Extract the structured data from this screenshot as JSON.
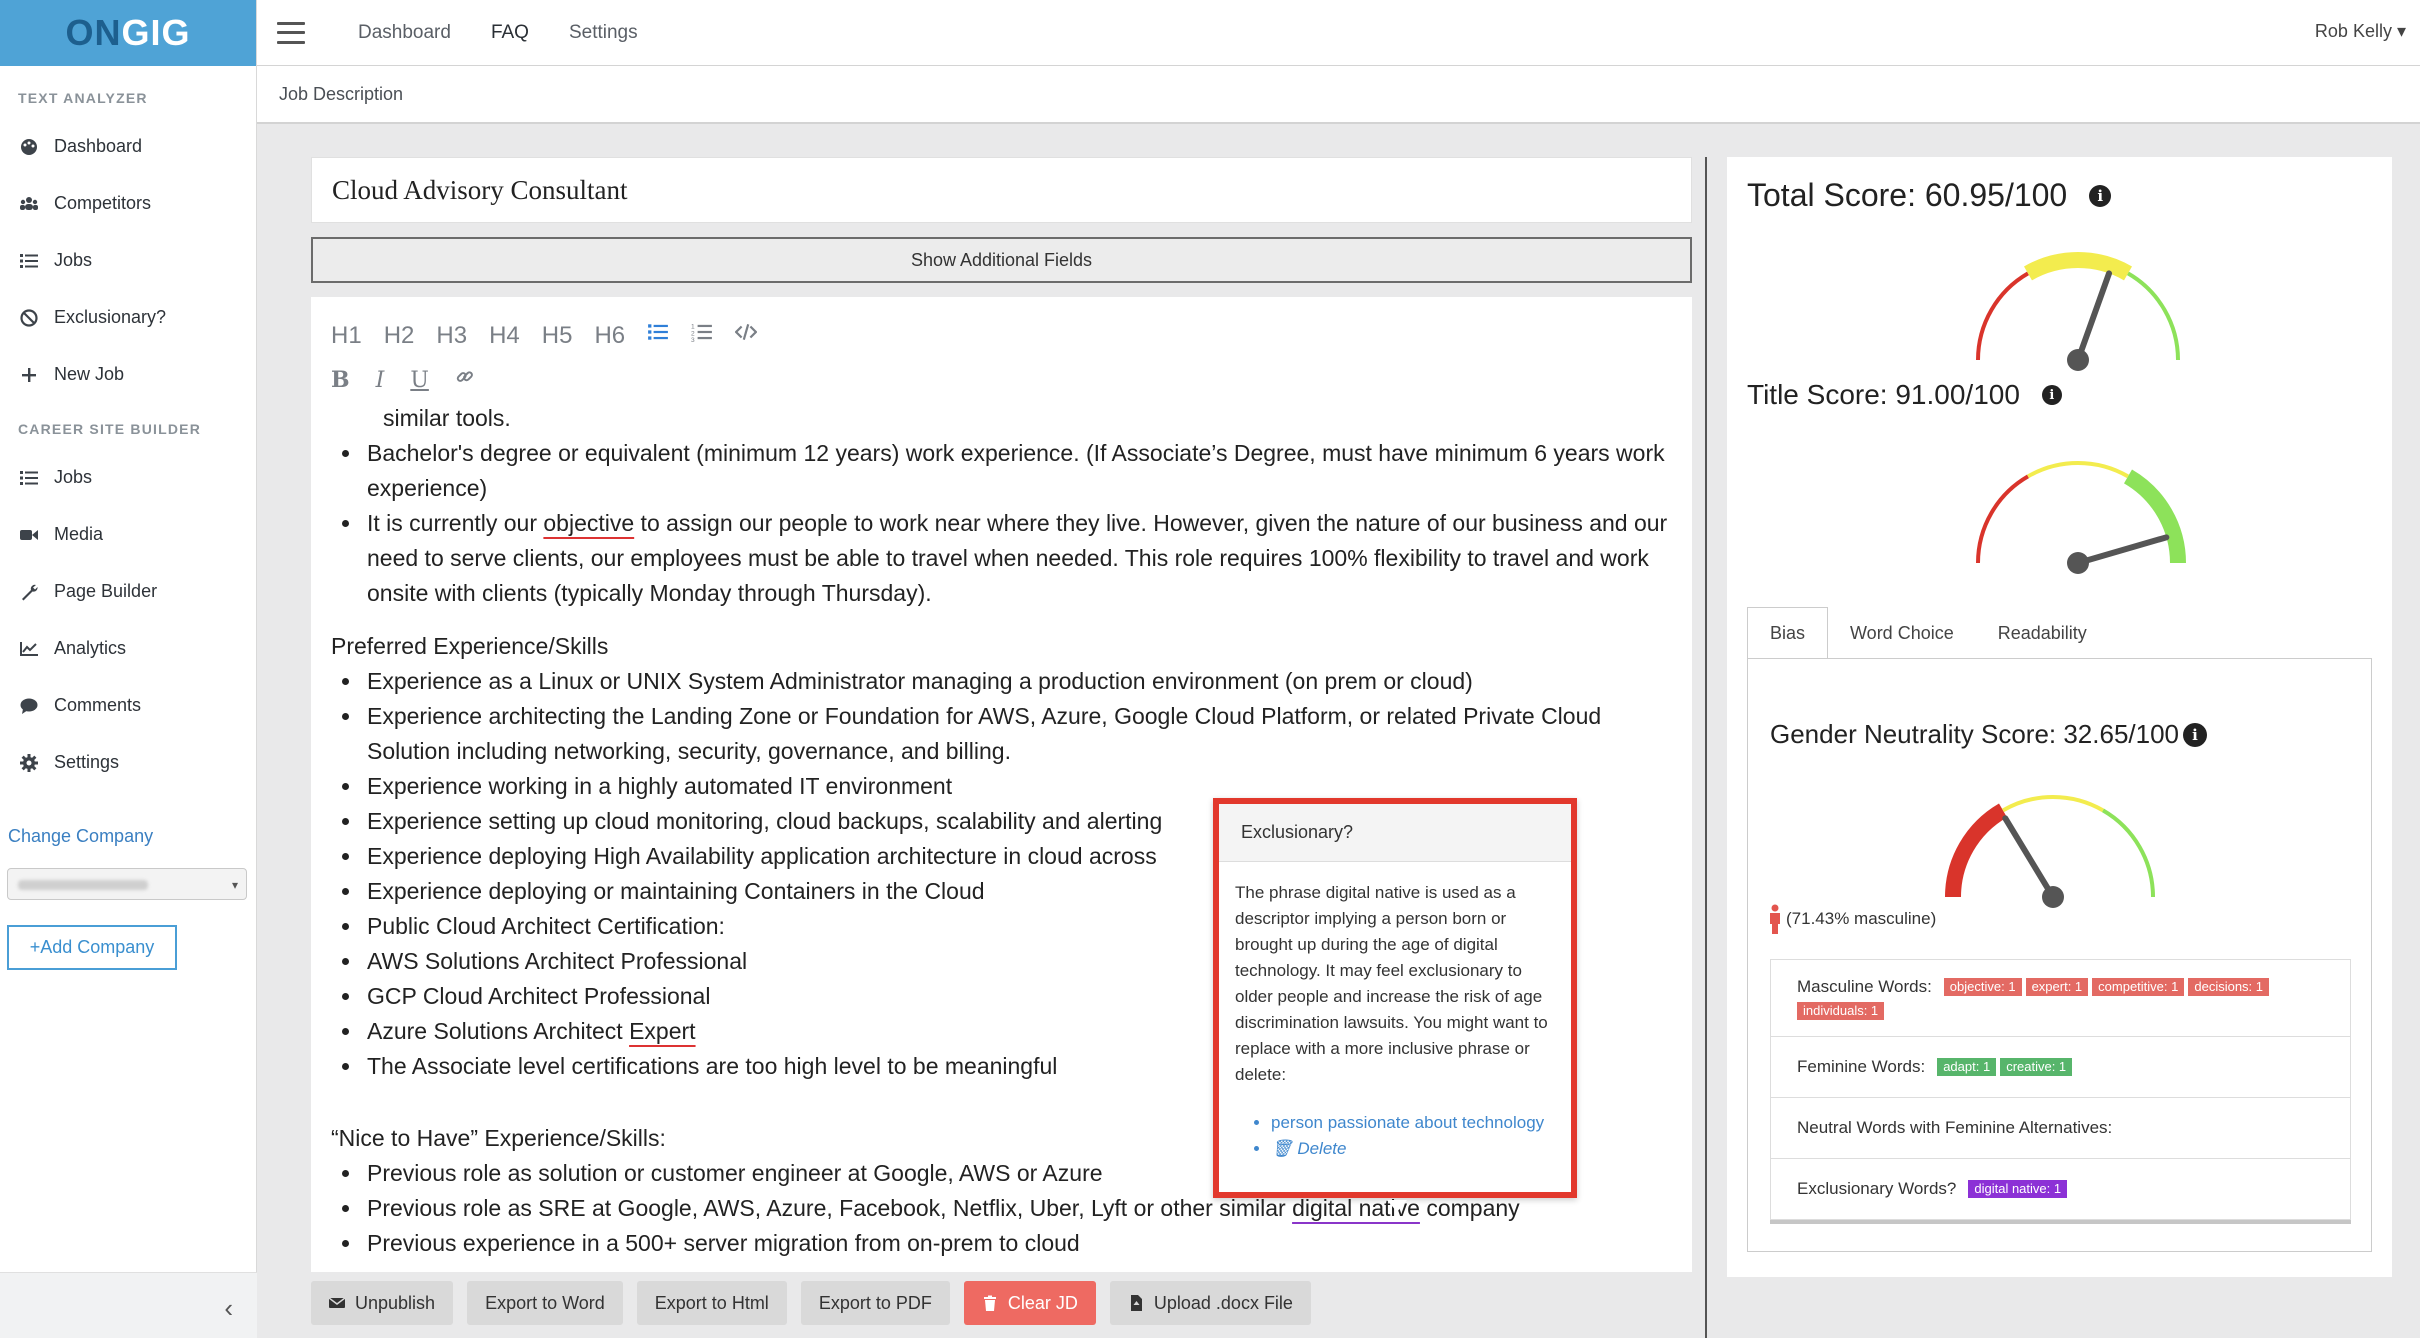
{
  "app": {
    "logo_text": "ONGIG"
  },
  "topnav": {
    "links": [
      "Dashboard",
      "FAQ",
      "Settings"
    ],
    "user": "Rob Kelly ▾"
  },
  "breadcrumb": "Job Description",
  "sidebar": {
    "section1": "TEXT ANALYZER",
    "text_analyzer_items": [
      {
        "label": "Dashboard",
        "icon": "palette-icon"
      },
      {
        "label": "Competitors",
        "icon": "users-icon"
      },
      {
        "label": "Jobs",
        "icon": "list-icon"
      },
      {
        "label": "Exclusionary?",
        "icon": "ban-icon"
      },
      {
        "label": "New Job",
        "icon": "plus-icon"
      }
    ],
    "section2": "CAREER SITE BUILDER",
    "career_items": [
      {
        "label": "Jobs",
        "icon": "list-icon"
      },
      {
        "label": "Media",
        "icon": "video-icon"
      },
      {
        "label": "Page Builder",
        "icon": "wrench-icon"
      },
      {
        "label": "Analytics",
        "icon": "chart-icon"
      },
      {
        "label": "Comments",
        "icon": "comment-icon"
      },
      {
        "label": "Settings",
        "icon": "gear-icon"
      }
    ],
    "change_company": "Change Company",
    "add_company": "+Add Company"
  },
  "editor": {
    "title": "Cloud Advisory Consultant",
    "show_fields": "Show Additional Fields",
    "toolbar": [
      "H1",
      "H2",
      "H3",
      "H4",
      "H5",
      "H6"
    ],
    "toolbar2": [
      "B",
      "I",
      "U"
    ],
    "continued_line": "similar tools.",
    "req_items": [
      {
        "text": "Bachelor's degree or equivalent (minimum 12 years) work experience. (If Associate’s Degree, must have minimum 6 years work experience)"
      }
    ],
    "objective_item": {
      "before": "It is currently our ",
      "flag": "objective",
      "after": " to assign our people to work near where they live. However, given the nature of our business and our need to serve clients, our employees must be able to travel when needed. This role requires 100% flexibility to travel and work onsite with clients (typically Monday through Thursday)."
    },
    "preferred_heading": "Preferred Experience/Skills",
    "preferred_items": [
      "Experience as a Linux or UNIX System Administrator managing a production environment (on prem or cloud)",
      "Experience architecting the Landing Zone or Foundation for AWS, Azure, Google Cloud Platform, or related Private Cloud Solution including networking, security, governance, and billing.",
      "Experience working in a highly automated IT environment",
      "Experience setting up cloud monitoring, cloud backups, scalability and alerting",
      "Experience deploying High Availability application architecture in cloud across",
      "Experience deploying or maintaining Containers in the Cloud",
      "Public Cloud Architect Certification:",
      "AWS Solutions Architect Professional",
      "GCP Cloud Architect Professional"
    ],
    "azure_item": {
      "before": "Azure Solutions Architect ",
      "flag": "Expert"
    },
    "associate_item": "The Associate level certifications are too high level to be meaningful",
    "nice_heading": "“Nice to Have” Experience/Skills:",
    "nice_items": [
      "Previous role as solution or customer engineer at Google, AWS or Azure"
    ],
    "sre_item": {
      "before": "Previous role as SRE at Google, AWS, Azure, Facebook, Netflix, Uber, Lyft or other similar ",
      "flag": "digital native",
      "after": " company"
    },
    "last_item": "Previous experience in a 500+ server migration from on-prem to cloud"
  },
  "actions": [
    {
      "label": "Unpublish",
      "icon": "envelope-icon"
    },
    {
      "label": "Export to Word",
      "icon": ""
    },
    {
      "label": "Export to Html",
      "icon": ""
    },
    {
      "label": "Export to PDF",
      "icon": ""
    },
    {
      "label": "Clear JD",
      "icon": "trash-icon"
    },
    {
      "label": "Upload .docx File",
      "icon": "file-icon"
    }
  ],
  "popover": {
    "title": "Exclusionary?",
    "body": "The phrase digital native is used as a descriptor implying a person born or brought up during the age of digital technology. It may feel exclusionary to older people and increase the risk of age discrimination lawsuits. You might want to replace with a more inclusive phrase or delete:",
    "suggestion": "person passionate about technology",
    "delete": "Delete"
  },
  "scores": {
    "total": {
      "label": "Total Score: 60.95/100",
      "value": 60.95
    },
    "title": {
      "label": "Title Score: 91.00/100",
      "value": 91.0
    },
    "gender": {
      "label": "Gender Neutrality Score: 32.65/100",
      "value": 32.65
    },
    "masculine_pct": "(71.43% masculine)",
    "tabs": [
      "Bias",
      "Word Choice",
      "Readability"
    ],
    "word_rows": [
      {
        "label": "Masculine Words:",
        "color": "red",
        "tags": [
          "objective: 1",
          "expert: 1",
          "competitive: 1",
          "decisions: 1",
          "individuals: 1"
        ]
      },
      {
        "label": "Feminine Words:",
        "color": "green",
        "tags": [
          "adapt: 1",
          "creative: 1"
        ]
      },
      {
        "label": "Neutral Words with Feminine Alternatives:",
        "color": "green",
        "tags": []
      },
      {
        "label": "Exclusionary Words?",
        "color": "purple",
        "tags": [
          "digital native: 1"
        ]
      }
    ]
  },
  "colors": {
    "brand": "#4fa3d6",
    "gauge_red": "#d9342b",
    "gauge_yellow": "#f3ec4e",
    "gauge_green": "#8de25a",
    "danger": "#ee6a62",
    "flag_red": "#d33333",
    "flag_purple": "#8a35c9"
  }
}
